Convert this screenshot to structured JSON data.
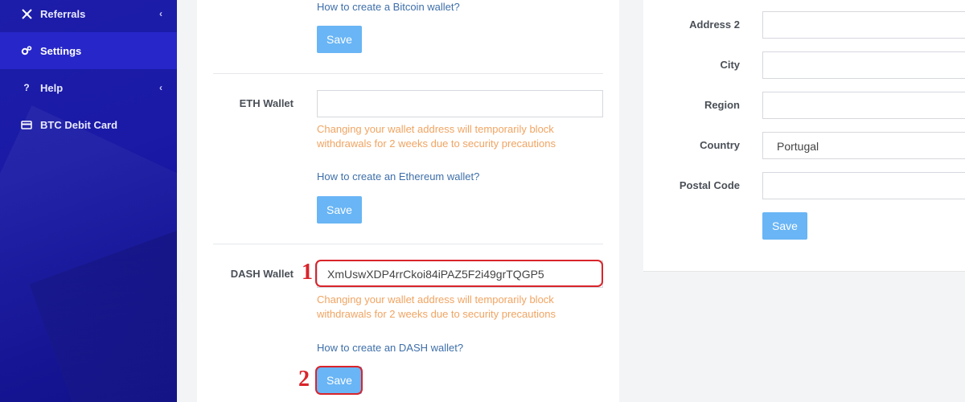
{
  "sidebar": {
    "items": [
      {
        "label": "Referrals",
        "icon": "referrals-icon",
        "has_submenu": true
      },
      {
        "label": "Settings",
        "icon": "settings-gears-icon",
        "active": true
      },
      {
        "label": "Help",
        "icon": "question-icon",
        "has_submenu": true
      },
      {
        "label": "BTC Debit Card",
        "icon": "credit-card-icon"
      }
    ]
  },
  "wallets": {
    "btc": {
      "help_link": "How to create a Bitcoin wallet?",
      "save_label": "Save"
    },
    "eth": {
      "label": "ETH Wallet",
      "value": "",
      "warning": "Changing your wallet address will temporarily block withdrawals for 2 weeks due to security precautions",
      "help_link": "How to create an Ethereum wallet?",
      "save_label": "Save"
    },
    "dash": {
      "label": "DASH Wallet",
      "value": "XmUswXDP4rrCkoi84iPAZ5F2i49grTQGP5",
      "warning": "Changing your wallet address will temporarily block withdrawals for 2 weeks due to security precautions",
      "help_link": "How to create an DASH wallet?",
      "save_label": "Save"
    }
  },
  "address": {
    "address2_label": "Address 2",
    "address2_value": "",
    "city_label": "City",
    "city_value": "",
    "region_label": "Region",
    "region_value": "",
    "country_label": "Country",
    "country_value": "Portugal",
    "postal_label": "Postal Code",
    "postal_value": "",
    "save_label": "Save"
  },
  "annotations": {
    "step1": "1",
    "step2": "2"
  },
  "colors": {
    "sidebar_bg": "#1a1aa6",
    "sidebar_active": "#2626c9",
    "button": "#69b5f5",
    "warning_text": "#f0a462",
    "link": "#3e6fa9",
    "annotation": "#d9242b"
  }
}
